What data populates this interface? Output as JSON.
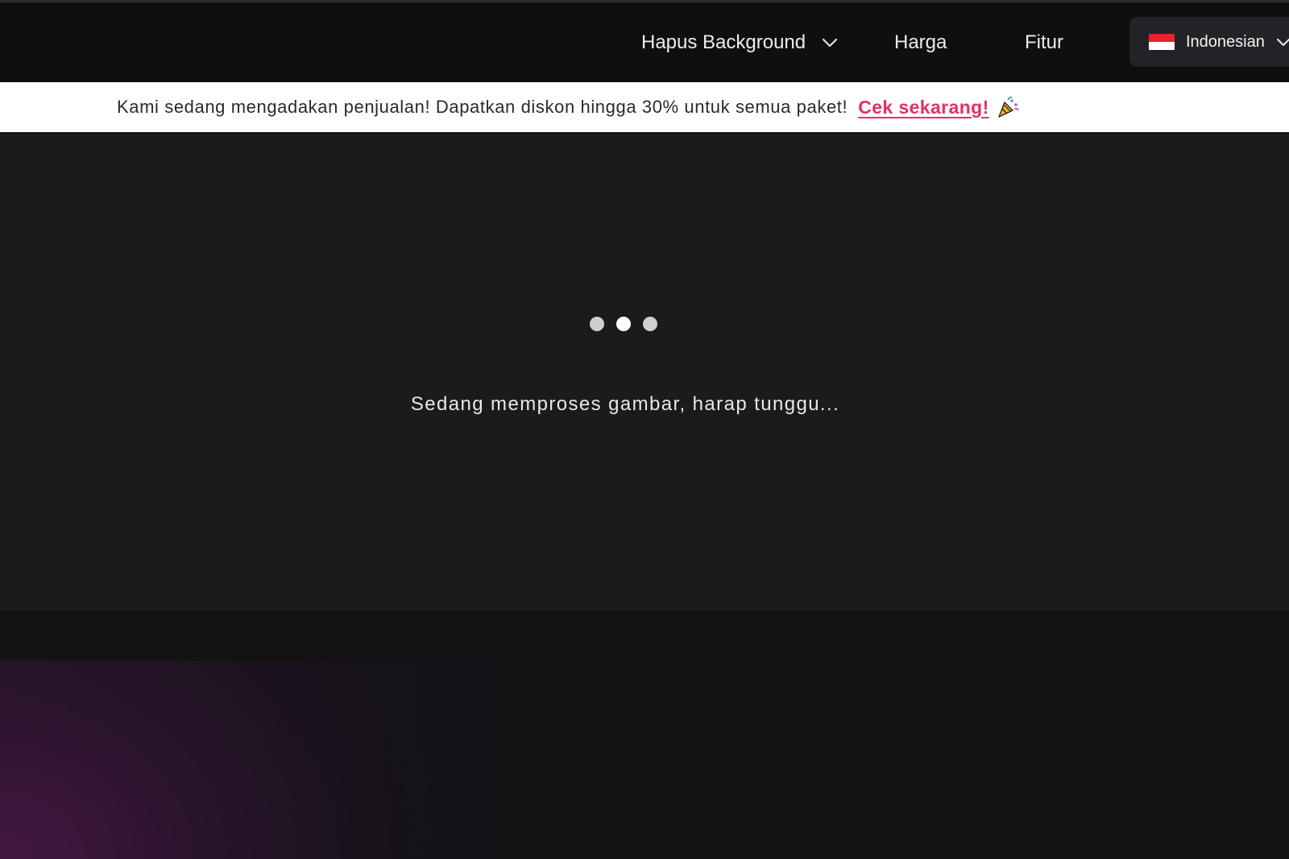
{
  "nav": {
    "items": [
      {
        "label": "Hapus Background",
        "has_dropdown": true
      },
      {
        "label": "Harga"
      },
      {
        "label": "Fitur"
      }
    ],
    "language": {
      "label": "Indonesian",
      "flag_icon": "indonesia-flag-icon",
      "chevron_icon": "chevron-down-icon"
    }
  },
  "promo": {
    "text": "Kami sedang mengadakan penjualan! Dapatkan diskon hingga 30% untuk semua paket!",
    "link_label": "Cek sekarang!",
    "icon": "party-popper-icon",
    "link_color": "#e1306c"
  },
  "processing": {
    "loader_icon": "loading-dots-icon",
    "message": "Sedang memproses gambar, harap tunggu..."
  },
  "colors": {
    "navbar_bg": "#0f0f11",
    "banner_bg": "#ffffff",
    "processing_bg": "#1b1b1e",
    "page_bg": "#131316",
    "accent_pink": "#e1306c"
  }
}
